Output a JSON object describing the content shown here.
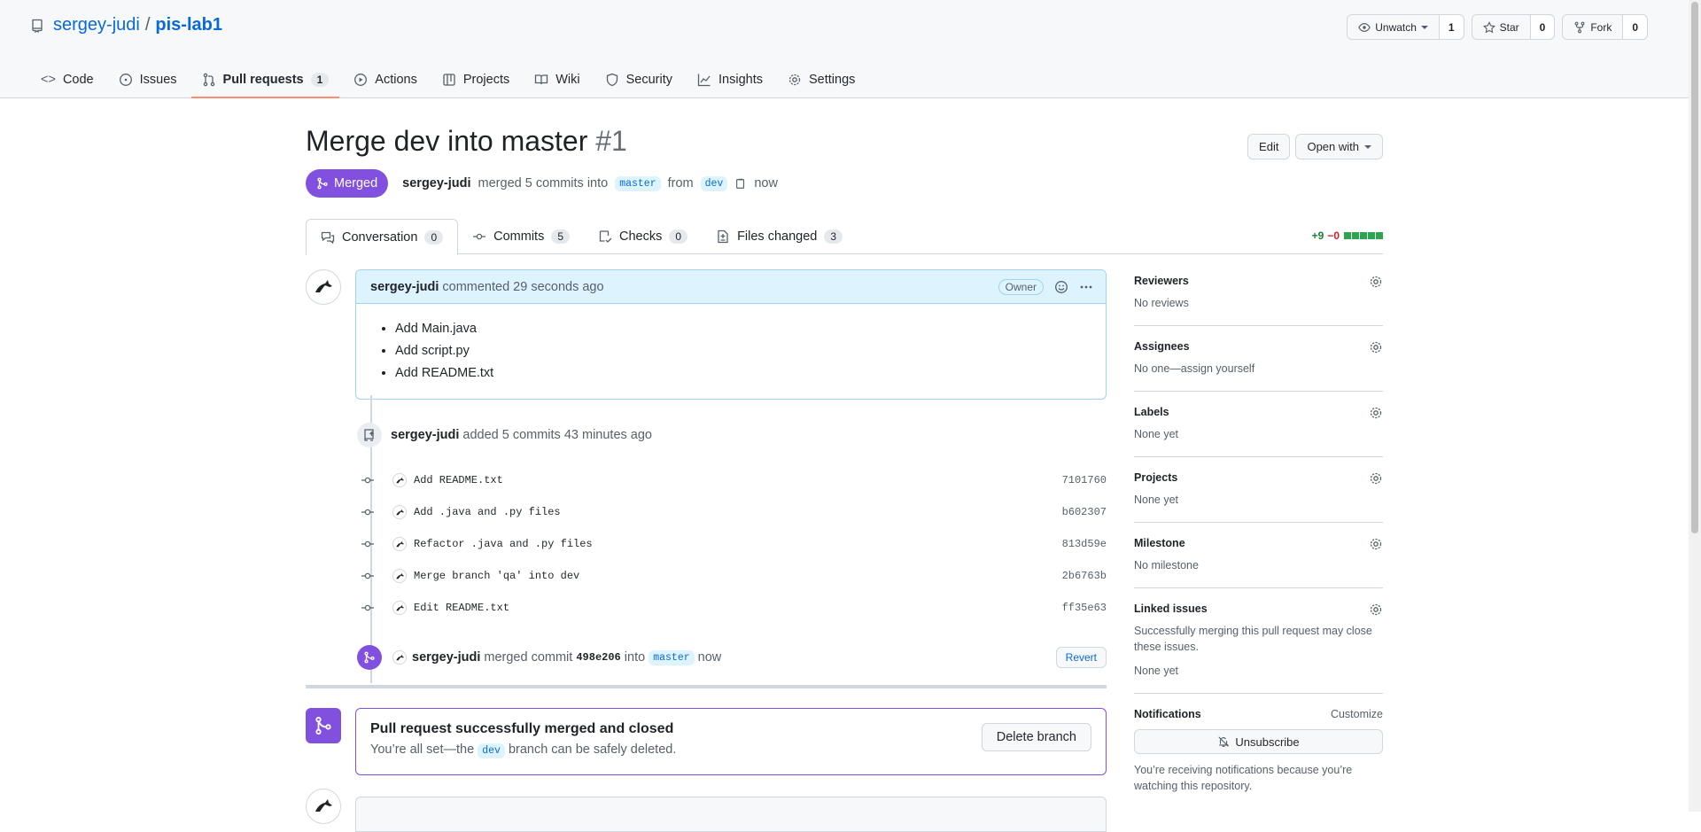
{
  "repo": {
    "owner": "sergey-judi",
    "separator": "/",
    "name": "pis-lab1"
  },
  "repo_actions": [
    {
      "label": "Unwatch",
      "count": "1",
      "icon": "eye-icon"
    },
    {
      "label": "Star",
      "count": "0",
      "icon": "star-icon"
    },
    {
      "label": "Fork",
      "count": "0",
      "icon": "fork-icon"
    }
  ],
  "nav_tabs": [
    {
      "label": "Code",
      "icon": "code-icon"
    },
    {
      "label": "Issues",
      "icon": "issue-icon"
    },
    {
      "label": "Pull requests",
      "count": "1",
      "icon": "pull-request-icon",
      "active": true
    },
    {
      "label": "Actions",
      "icon": "play-icon"
    },
    {
      "label": "Projects",
      "icon": "table-icon"
    },
    {
      "label": "Wiki",
      "icon": "book-icon"
    },
    {
      "label": "Security",
      "icon": "shield-icon"
    },
    {
      "label": "Insights",
      "icon": "graph-icon"
    },
    {
      "label": "Settings",
      "icon": "gear-icon"
    }
  ],
  "pr": {
    "title": "Merge dev into master",
    "number": "#1",
    "edit_label": "Edit",
    "open_with_label": "Open with",
    "state": "Merged",
    "author": "sergey-judi",
    "merged_text": "merged 5 commits into",
    "base": "master",
    "from_text": "from",
    "head": "dev",
    "time": "now"
  },
  "pr_tabs": [
    {
      "label": "Conversation",
      "count": "0"
    },
    {
      "label": "Commits",
      "count": "5"
    },
    {
      "label": "Checks",
      "count": "0"
    },
    {
      "label": "Files changed",
      "count": "3"
    }
  ],
  "diffstat": {
    "additions": "+9",
    "deletions": "−0"
  },
  "comment": {
    "author": "sergey-judi",
    "action": "commented 29 seconds ago",
    "role": "Owner",
    "items": [
      "Add Main.java",
      "Add script.py",
      "Add README.txt"
    ]
  },
  "commits_event": {
    "author": "sergey-judi",
    "text": "added 5 commits 43 minutes ago"
  },
  "commits": [
    {
      "message": "Add README.txt",
      "sha": "7101760"
    },
    {
      "message": "Add .java and .py files",
      "sha": "b602307"
    },
    {
      "message": "Refactor .java and .py files",
      "sha": "813d59e"
    },
    {
      "message": "Merge branch 'qa' into dev",
      "sha": "2b6763b"
    },
    {
      "message": "Edit README.txt",
      "sha": "ff35e63"
    }
  ],
  "merge_event": {
    "author": "sergey-judi",
    "text": "merged commit",
    "sha": "498e206",
    "into": "into",
    "branch": "master",
    "time": "now",
    "revert_label": "Revert"
  },
  "merged_box": {
    "title": "Pull request successfully merged and closed",
    "text_before": "You’re all set—the",
    "branch": "dev",
    "text_after": "branch can be safely deleted.",
    "delete_label": "Delete branch"
  },
  "sidebar": {
    "reviewers": {
      "title": "Reviewers",
      "value": "No reviews"
    },
    "assignees": {
      "title": "Assignees",
      "value": "No one—assign yourself"
    },
    "labels": {
      "title": "Labels",
      "value": "None yet"
    },
    "projects": {
      "title": "Projects",
      "value": "None yet"
    },
    "milestone": {
      "title": "Milestone",
      "value": "No milestone"
    },
    "linked": {
      "title": "Linked issues",
      "desc": "Successfully merging this pull request may close these issues.",
      "value": "None yet"
    },
    "notifications": {
      "title": "Notifications",
      "customize": "Customize",
      "unsubscribe": "Unsubscribe",
      "note": "You’re receiving notifications because you’re watching this repository."
    }
  },
  "colors": {
    "accent": "#0969da",
    "merged": "#8250df",
    "add": "#1a7f37",
    "del": "#cf222e"
  }
}
